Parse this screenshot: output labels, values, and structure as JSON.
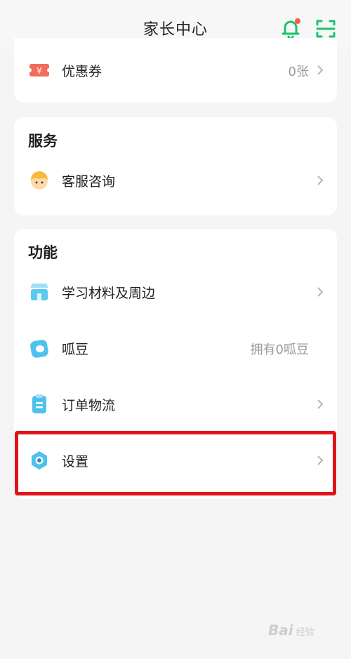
{
  "header": {
    "title": "家长中心",
    "bell_icon": "bell-icon",
    "scan_icon": "scan-icon",
    "accent_color": "#19c36b",
    "badge_color": "#ff5a3c"
  },
  "coupon": {
    "label": "优惠券",
    "value": "0张",
    "icon": "coupon-icon"
  },
  "service": {
    "title": "服务",
    "items": [
      {
        "label": "客服咨询",
        "icon": "customer-service-avatar-icon"
      }
    ]
  },
  "features": {
    "title": "功能",
    "items": [
      {
        "label": "学习材料及周边",
        "value": "",
        "icon": "shop-icon"
      },
      {
        "label": "呱豆",
        "value": "拥有0呱豆",
        "icon": "bean-icon"
      },
      {
        "label": "订单物流",
        "value": "",
        "icon": "order-clipboard-icon"
      },
      {
        "label": "设置",
        "value": "",
        "icon": "settings-gear-icon"
      }
    ]
  },
  "highlight_color": "#e0141a",
  "watermark": {
    "text": "Bai",
    "sub": "经验",
    "icon": "baidu-paw-logo"
  }
}
